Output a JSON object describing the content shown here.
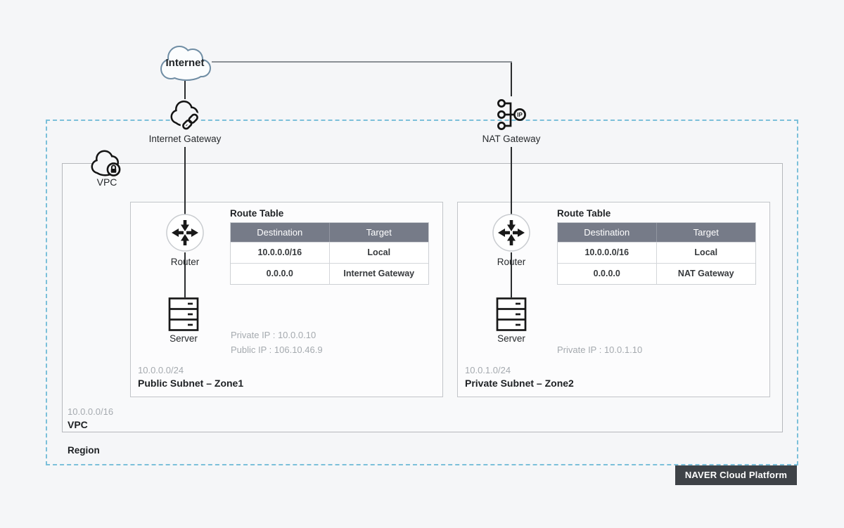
{
  "diagram": {
    "internet_label": "Internet",
    "internet_gateway_label": "Internet Gateway",
    "nat_gateway_label": "NAT Gateway",
    "nat_icon_text": "IP",
    "region_label": "Region",
    "vpc_icon_label": "VPC",
    "vpc_cidr": "10.0.0.0/16",
    "vpc_label": "VPC",
    "badge_label": "NAVER Cloud Platform"
  },
  "subnets": [
    {
      "router_label": "Router",
      "server_label": "Server",
      "route_table": {
        "title": "Route Table",
        "headers": [
          "Destination",
          "Target"
        ],
        "rows": [
          [
            "10.0.0.0/16",
            "Local"
          ],
          [
            "0.0.0.0",
            "Internet Gateway"
          ]
        ]
      },
      "ip_lines": [
        "Private IP : 10.0.0.10",
        "Public IP : 106.10.46.9"
      ],
      "cidr": "10.0.0.0/24",
      "name": "Public Subnet – Zone1"
    },
    {
      "router_label": "Router",
      "server_label": "Server",
      "route_table": {
        "title": "Route Table",
        "headers": [
          "Destination",
          "Target"
        ],
        "rows": [
          [
            "10.0.0.0/16",
            "Local"
          ],
          [
            "0.0.0.0",
            "NAT Gateway"
          ]
        ]
      },
      "ip_lines": [
        "Private IP : 10.0.1.10"
      ],
      "cidr": "10.0.1.0/24",
      "name": "Private Subnet – Zone2"
    }
  ],
  "colors": {
    "page_bg": "#f5f6f8",
    "region_dashed_border": "#7cc0da",
    "table_header_bg": "#767b88",
    "badge_bg": "#3e4247",
    "muted_text": "#a5aaaf",
    "internet_cloud_stroke": "#6f8da4",
    "connector_gray": "#8b9095"
  }
}
